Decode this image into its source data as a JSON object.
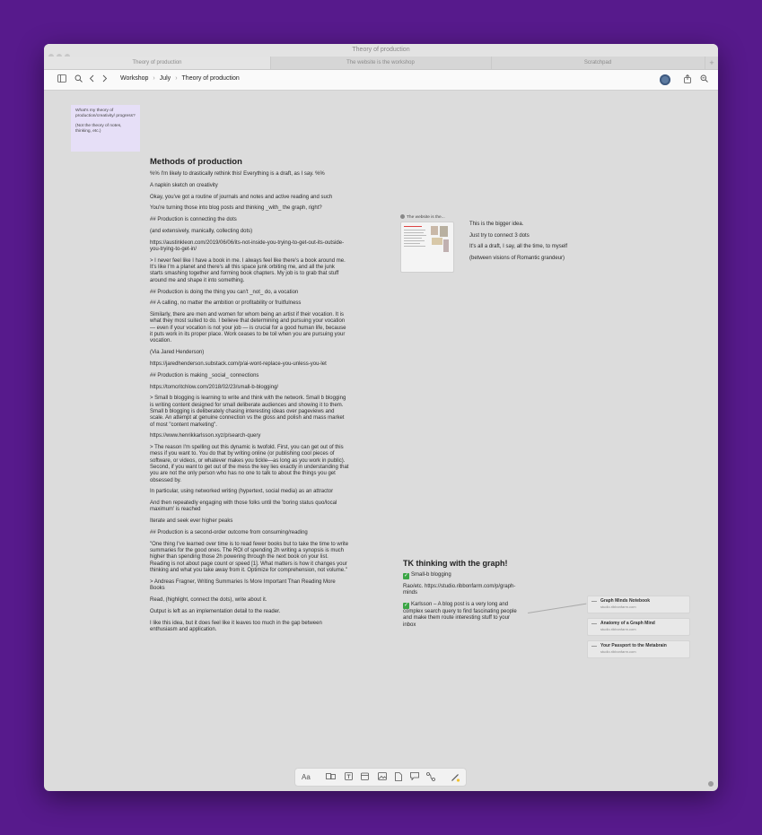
{
  "window": {
    "title": "Theory of production"
  },
  "tabs": [
    {
      "label": "Theory of production"
    },
    {
      "label": "The website is the workshop"
    },
    {
      "label": "Scratchpad"
    }
  ],
  "toolbar": {
    "breadcrumbs": [
      "Workshop",
      "July",
      "Theory of production"
    ],
    "icons": [
      "sidebar-icon",
      "search-icon",
      "back-icon",
      "forward-icon",
      "share-icon",
      "zoom-icon"
    ]
  },
  "sticky": {
    "line1": "What's my theory of production/creativity/ progress?",
    "line2": "(Not the theory of notes, thinking, etc.)"
  },
  "doc": {
    "title": "Methods of production",
    "paragraphs": [
      "%% I'm likely to drastically rethink this! Everything is a draft, as I say. %%",
      "A napkin sketch on creativity",
      "Okay, you've got a routine of journals and notes and active reading and such",
      "You're turning those into blog posts and thinking _with_ the graph, right?",
      "## Production is connecting the dots",
      "(and extensively, manically, collecting dots)",
      "https://austinkleon.com/2019/06/06/its-not-inside-you-trying-to-get-out-its-outside-you-trying-to-get-in/",
      "> I never feel like I have a book in me. I always feel like there's a book around me. It's like I'm a planet and there's all this space junk orbiting me, and all the junk starts smashing together and forming book chapters. My job is to grab that stuff around me and shape it into something.",
      "## Production is doing the thing you can't _not_ do, a vocation",
      "## A calling, no matter the ambition or profitability or fruitfulness",
      "Similarly, there are men and women for whom being an artist if their vocation. It is what they most suited to do. I believe that determining and pursuing your vocation — even if your vocation is not your job — is crucial for a good human life, because it puts work in its proper place. Work ceases to be toil when you are pursuing your vocation.",
      "(Via Jared Henderson)",
      "https://jaredhenderson.substack.com/p/ai-wont-replace-you-unless-you-let",
      "## Production is making _social_ connections",
      "https://tomcritchlow.com/2018/02/23/small-b-blogging/",
      "> Small b blogging is learning to write and think with the network. Small b blogging is writing content designed for small deliberate audiences and showing it to them. Small b blogging is deliberately chasing interesting ideas over pageviews and scale. An attempt at genuine connection vs the gloss and polish and mass market of most \"content marketing\".",
      "https://www.henrikkarlsson.xyz/p/search-query",
      "> The reason I'm spelling out this dynamic is twofold. First, you can get out of this mess if you want to. You do that by writing online (or publishing cool pieces of software, or videos, or whatever makes you tickle—as long as you work in public). Second, if you want to get out of the mess the key lies exactly in understanding that you are not the only person who has no one to talk to about the things you get obsessed by.",
      "In particular, using networked writing (hypertext, social media) as an attractor",
      "And then repeatedly engaging with those folks until the 'boring status quo/local maximum' is reached",
      "Iterate and seek ever higher peaks",
      "## Production is a second-order outcome from consuming/reading",
      "\"One thing I've learned over time is to read fewer books but to take the time to write summaries for the good ones. The ROI of spending 2h writing a synopsis is much higher than spending those 2h powering through the next book on your list. Reading is not about page count or speed [1]. What matters is how it changes your thinking and what you take away from it. Optimize for comprehension, not volume.\"",
      "> Andreas Fragner, Writing Summaries Is More Important Than Reading More Books",
      "Read, (highlight, connect the dots), write about it.",
      "Output is left as an implementation detail to the reader.",
      "I like this idea, but it does feel like it leaves too much in the gap between enthusiasm and application."
    ]
  },
  "card": {
    "title": "The website is the..."
  },
  "bigidea": {
    "lines": [
      "This is the bigger idea.",
      "Just try to connect 3 dots",
      "It's all a draft, I say, all the time, to myself",
      "(between visions of Romantic grandeur)"
    ]
  },
  "tk": {
    "title": "TK thinking with the graph!",
    "item1": "Small-b blogging",
    "item2": "Rao/etc. https://studio.ribbonfarm.com/p/graph-minds",
    "item3": "Karlsson – A blog post is a very long and complex search query to find fascinating people and make them route interesting stuff to your inbox"
  },
  "links": [
    {
      "title": "Graph Minds Notebook",
      "domain": "studio.ribbonfarm.com"
    },
    {
      "title": "Anatomy of a Graph Mind",
      "domain": "studio.ribbonfarm.com"
    },
    {
      "title": "Your Passport to the Metabrain",
      "domain": "studio.ribbonfarm.com"
    }
  ],
  "bottombar": {
    "text_label": "Aa",
    "icons": [
      "cards-icon",
      "text-block-icon",
      "calendar-icon",
      "image-icon",
      "file-icon",
      "comment-icon",
      "connector-icon",
      "pen-icon"
    ]
  },
  "colors": {
    "background": "#571a8c",
    "canvas": "#dcdcdc",
    "sticky": "#e6dff7",
    "check": "#3aa544"
  }
}
